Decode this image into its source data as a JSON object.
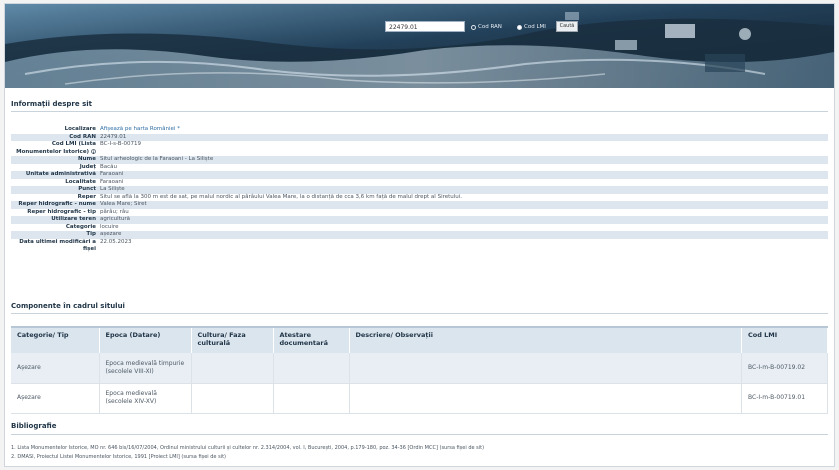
{
  "search": {
    "value": "22479.01",
    "radio_ran": "Cod RAN",
    "radio_lmi": "Cod LMI",
    "button": "Caută"
  },
  "info_title": "Informații despre sit",
  "info_rows": [
    {
      "label": "Localizare",
      "value": "Afișează pe harta României *"
    },
    {
      "label": "Cod RAN",
      "value": "22479.01"
    },
    {
      "label": "Cod LMI (Lista Monumentelor Istorice)",
      "value": "BC-I-s-B-00719"
    },
    {
      "label": "Nume",
      "value": "Situl arheologic de la Faraoani - La Siliște"
    },
    {
      "label": "Județ",
      "value": "Bacău"
    },
    {
      "label": "Unitate administrativă",
      "value": "Faraoani"
    },
    {
      "label": "Localitate",
      "value": "Faraoani"
    },
    {
      "label": "Punct",
      "value": "La Siliște"
    },
    {
      "label": "Reper",
      "value": "Situl se află la 300 m est de sat, pe malul nordic al pârâului Valea Mare, la o distanță de cca 3,6 km față de malul drept al Siretului."
    },
    {
      "label": "Reper hidrografic - nume",
      "value": "Valea Mare; Siret"
    },
    {
      "label": "Reper hidrografic - tip",
      "value": "pârâu; râu"
    },
    {
      "label": "Utilizare teren",
      "value": "agricultură"
    },
    {
      "label": "Categorie",
      "value": "locuire"
    },
    {
      "label": "Tip",
      "value": "așezare"
    },
    {
      "label": "Data ultimei modificări a fișei",
      "value": "22.05.2023"
    }
  ],
  "components_title": "Componente în cadrul sitului",
  "table": {
    "headers": [
      "Categorie/ Tip",
      "Epoca (Datare)",
      "Cultura/ Faza culturală",
      "Atestare documentară",
      "Descriere/ Observații",
      "Cod LMI"
    ],
    "rows": [
      [
        "Așezare",
        "Epoca medievală timpurie (secolele VIII-XI)",
        "",
        "",
        "",
        "BC-I-m-B-00719.02"
      ],
      [
        "Așezare",
        "Epoca medievală (secolele XIV-XV)",
        "",
        "",
        "",
        "BC-I-m-B-00719.01"
      ]
    ]
  },
  "bibliography_title": "Bibliografie",
  "bibliography": [
    "1. Lista Monumentelor Istorice, MO nr. 646 bis/16/07/2004, Ordinul ministrului culturii și cultelor nr. 2.314/2004, vol. I, București, 2004, p.179-180, poz. 34-36 [Ordin MCC] (sursa fișei de sit)",
    "2. DMASI, Proiectul Listei Monumentelor Istorice, 1991 [Proiect LMI] (sursa fișei de sit)"
  ],
  "colors": {
    "header_bg": "#dbe5ee",
    "row_alt": "#dde6ef",
    "title": "#1f3446",
    "link": "#2f6ea6"
  }
}
